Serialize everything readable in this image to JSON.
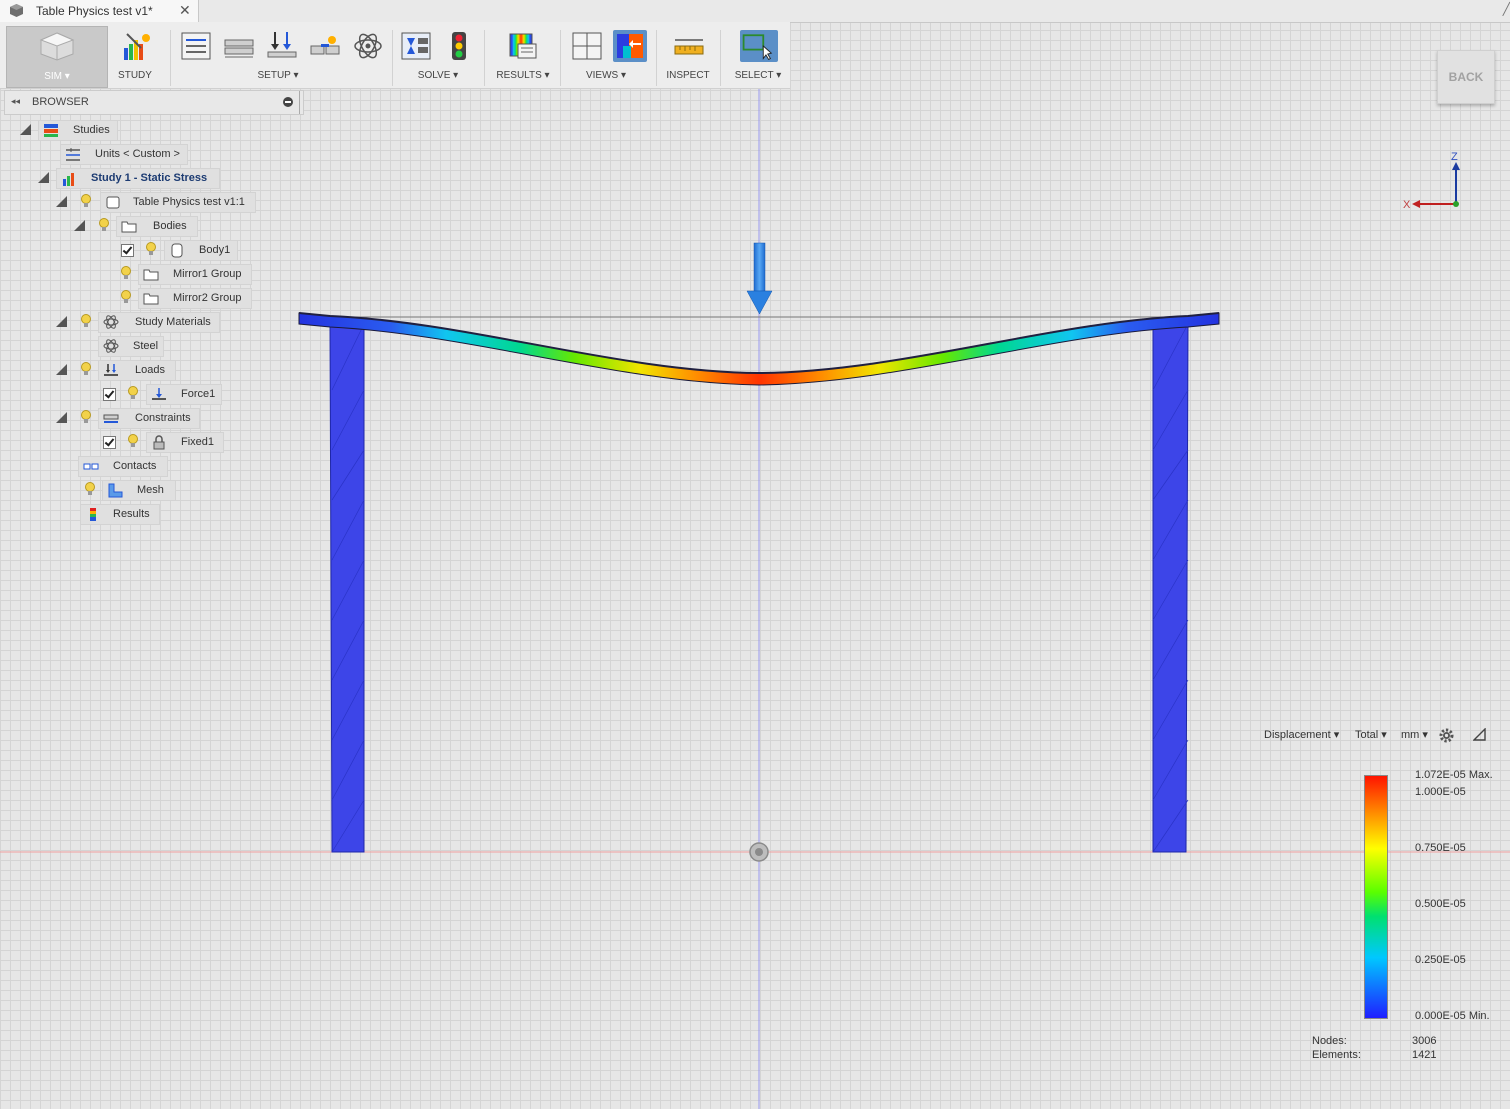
{
  "window": {
    "doc_title": "Table Physics test v1*"
  },
  "ribbon": {
    "workspace": "SIM",
    "groups": {
      "study": "STUDY",
      "setup": "SETUP",
      "solve": "SOLVE",
      "results": "RESULTS",
      "views": "VIEWS",
      "inspect": "INSPECT",
      "select": "SELECT"
    },
    "back": "BACK"
  },
  "browser": {
    "title": "BROWSER",
    "items": [
      {
        "label": "Studies",
        "icon": "studies-icon"
      },
      {
        "label": "Units < Custom >",
        "icon": "units-icon"
      },
      {
        "label": "Study 1 - Static Stress",
        "icon": "study-icon"
      },
      {
        "label": "Table Physics test v1:1",
        "icon": "component-icon"
      },
      {
        "label": "Bodies",
        "icon": "folder-icon"
      },
      {
        "label": "Body1",
        "icon": "body-icon"
      },
      {
        "label": "Mirror1 Group",
        "icon": "folder-icon"
      },
      {
        "label": "Mirror2 Group",
        "icon": "folder-icon"
      },
      {
        "label": "Study Materials",
        "icon": "materials-icon"
      },
      {
        "label": "Steel",
        "icon": "material-icon"
      },
      {
        "label": "Loads",
        "icon": "loads-icon"
      },
      {
        "label": "Force1",
        "icon": "force-icon"
      },
      {
        "label": "Constraints",
        "icon": "constraints-icon"
      },
      {
        "label": "Fixed1",
        "icon": "lock-icon"
      },
      {
        "label": "Contacts",
        "icon": "contacts-icon"
      },
      {
        "label": "Mesh",
        "icon": "mesh-icon"
      },
      {
        "label": "Results",
        "icon": "results-icon"
      }
    ]
  },
  "viewcube": {
    "z": "Z",
    "x": "X"
  },
  "legend": {
    "result_type": "Displacement",
    "component": "Total",
    "unit": "mm",
    "max_label": "1.072E-05 Max.",
    "ticks": [
      "1.000E-05",
      "0.750E-05",
      "0.500E-05",
      "0.250E-05"
    ],
    "min_label": "0.000E-05 Min.",
    "colors": [
      "#1f1fff",
      "#00c8ff",
      "#00e070",
      "#5aff00",
      "#ffff00",
      "#ff8a00",
      "#ff1400"
    ]
  },
  "stats": {
    "nodes_label": "Nodes:",
    "nodes": "3006",
    "elements_label": "Elements:",
    "elements": "1421"
  }
}
